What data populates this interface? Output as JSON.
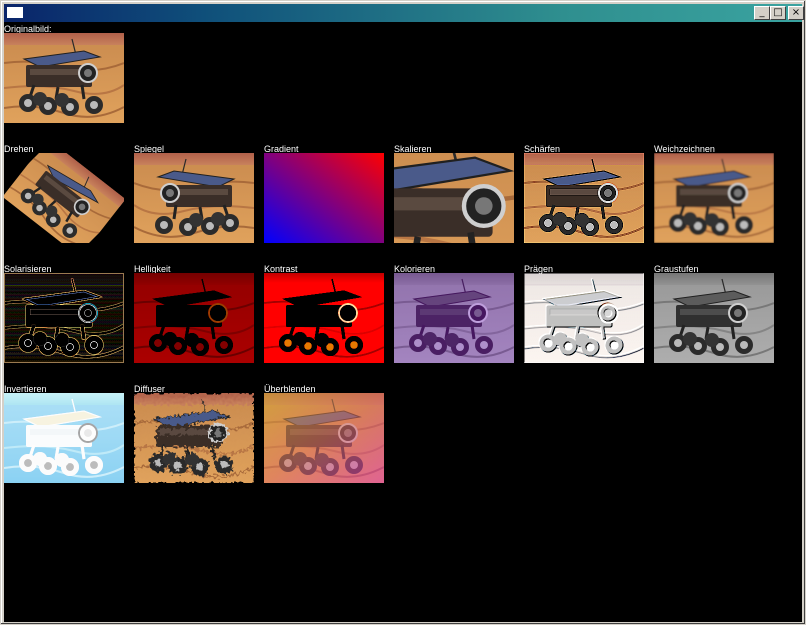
{
  "window": {
    "title": "",
    "buttons": {
      "minimize": "_",
      "maximize": "□",
      "close": "×"
    }
  },
  "original": {
    "label": "Originalbild:"
  },
  "effects": [
    {
      "label": "Drehen"
    },
    {
      "label": "Spiegel"
    },
    {
      "label": "Gradient"
    },
    {
      "label": "Skalieren"
    },
    {
      "label": "Schärfen"
    },
    {
      "label": "Weichzeichnen"
    },
    {
      "label": "Solarisieren"
    },
    {
      "label": "Helligkeit"
    },
    {
      "label": "Kontrast"
    },
    {
      "label": "Kolorieren"
    },
    {
      "label": "Prägen"
    },
    {
      "label": "Graustufen"
    },
    {
      "label": "Invertieren"
    },
    {
      "label": "Diffuser"
    },
    {
      "label": "Überblenden"
    }
  ]
}
